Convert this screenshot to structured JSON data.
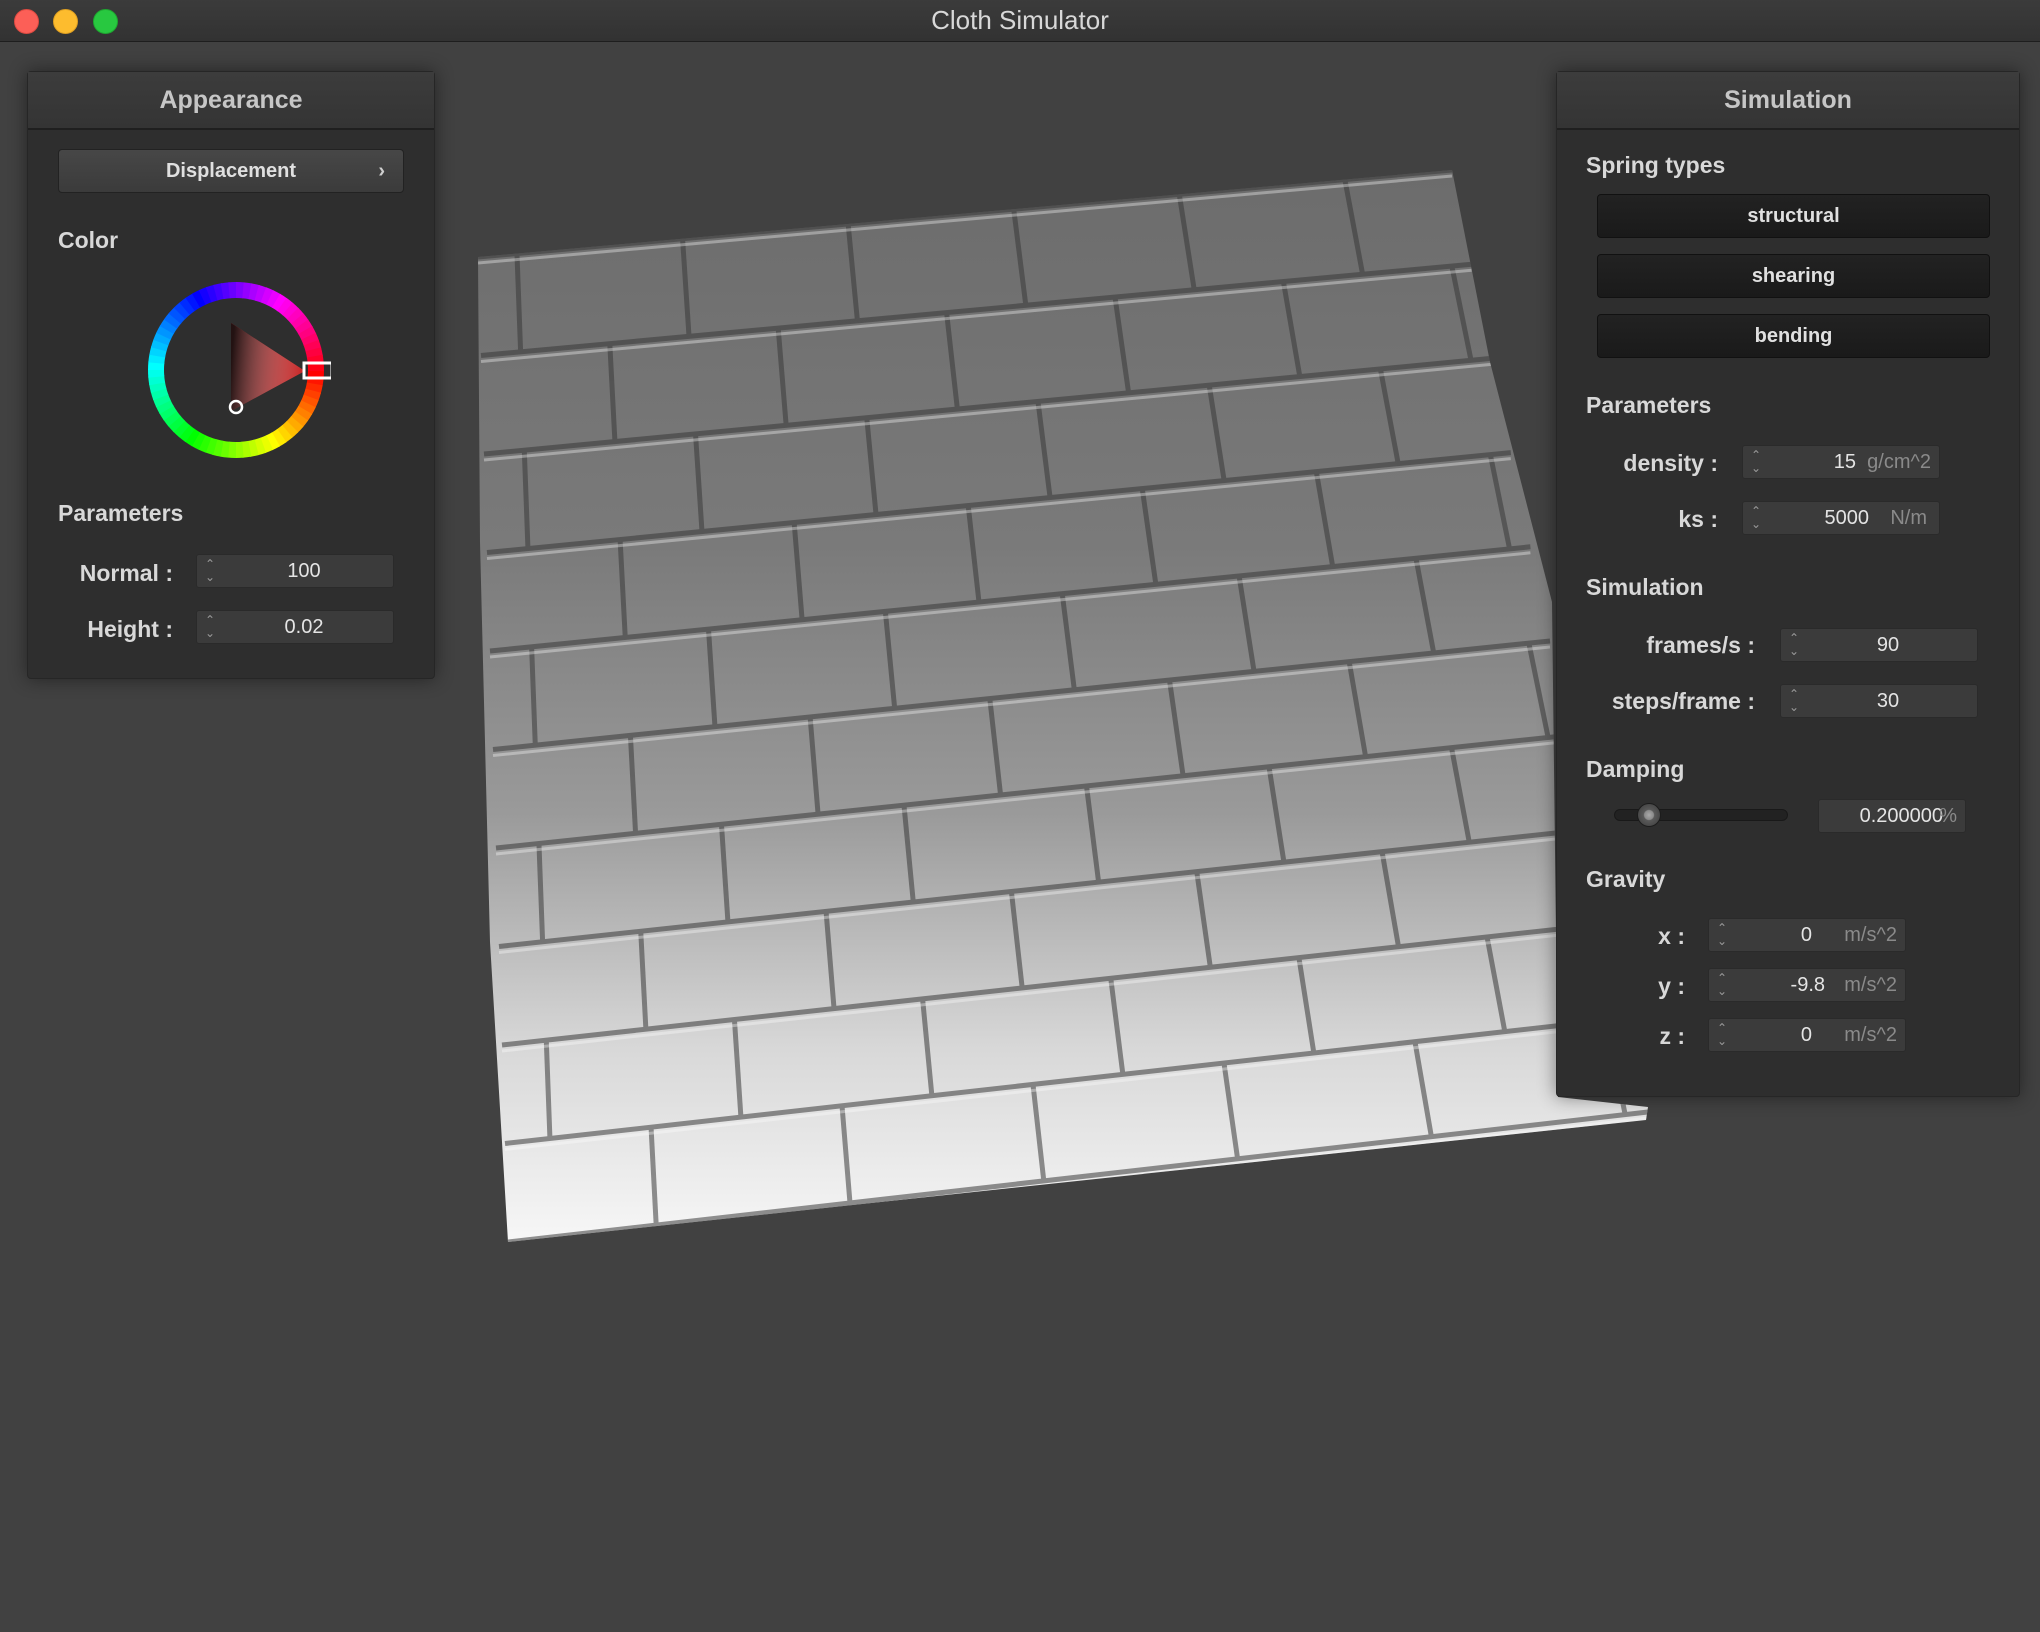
{
  "window": {
    "title": "Cloth Simulator"
  },
  "appearance": {
    "title": "Appearance",
    "shader_select": {
      "value": "Displacement",
      "chevron": "›"
    },
    "color_label": "Color",
    "color_value": "#c62020",
    "parameters_label": "Parameters",
    "normal": {
      "label": "Normal :",
      "value": "100"
    },
    "height": {
      "label": "Height :",
      "value": "0.02"
    }
  },
  "simulation": {
    "title": "Simulation",
    "spring_types_label": "Spring types",
    "springs": [
      "structural",
      "shearing",
      "bending"
    ],
    "parameters_label": "Parameters",
    "density": {
      "label": "density :",
      "value": "15",
      "unit": "g/cm^2"
    },
    "ks": {
      "label": "ks :",
      "value": "5000",
      "unit": "N/m"
    },
    "sim_label": "Simulation",
    "fps": {
      "label": "frames/s :",
      "value": "90"
    },
    "steps": {
      "label": "steps/frame :",
      "value": "30"
    },
    "damping_label": "Damping",
    "damping": {
      "value": "0.200000",
      "unit": "%",
      "slider_fraction": 0.2
    },
    "gravity_label": "Gravity",
    "gravity": [
      {
        "label": "x :",
        "value": "0",
        "unit": "m/s^2"
      },
      {
        "label": "y :",
        "value": "-9.8",
        "unit": "m/s^2"
      },
      {
        "label": "z :",
        "value": "0",
        "unit": "m/s^2"
      }
    ]
  },
  "icons": {
    "close": "close-dot-icon",
    "minimize": "minimize-dot-icon",
    "maximize": "maximize-dot-icon",
    "chevron": "chevron-right-icon",
    "spinner": "spinner-arrows-icon",
    "color_wheel": "color-wheel-icon"
  }
}
